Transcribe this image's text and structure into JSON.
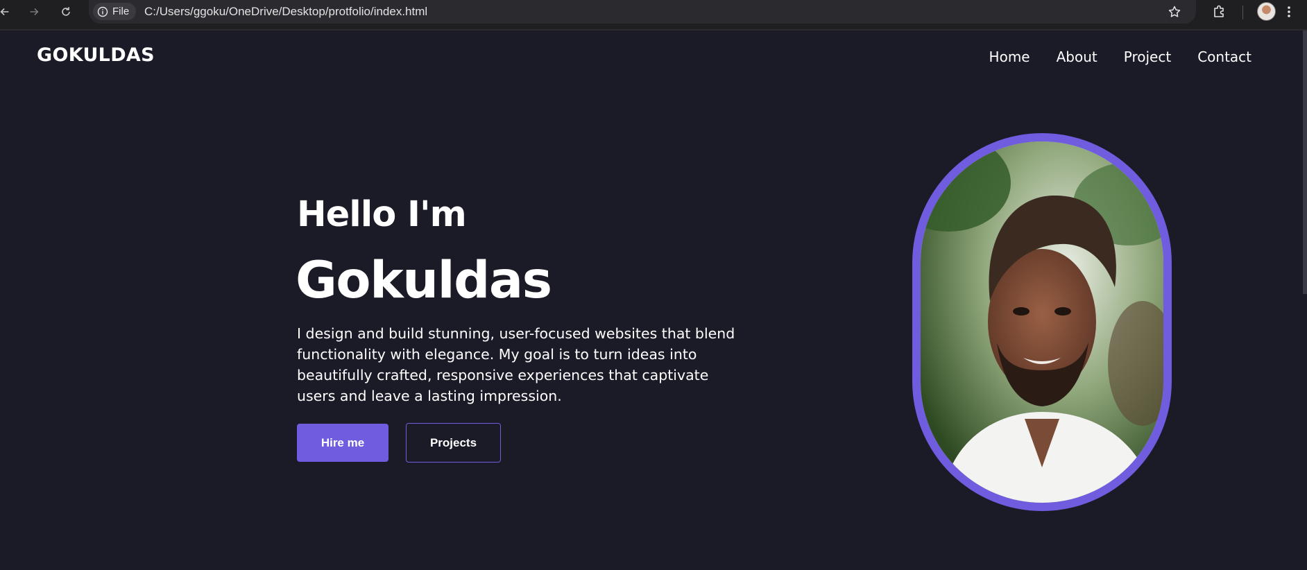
{
  "browser": {
    "site_chip_label": "File",
    "url": "C:/Users/ggoku/OneDrive/Desktop/protfolio/index.html"
  },
  "site": {
    "logo": "GOKULDAS",
    "nav": [
      "Home",
      "About",
      "Project",
      "Contact"
    ]
  },
  "hero": {
    "greeting": "Hello I'm",
    "name": "Gokuldas",
    "description": "I design and build stunning, user-focused websites that blend functionality with elegance. My goal is to turn ideas into beautifully crafted, responsive experiences that captivate users and leave a lasting impression.",
    "primary_button": "Hire me",
    "secondary_button": "Projects"
  },
  "colors": {
    "background": "#1b1a27",
    "accent": "#6f5cde",
    "text": "#ffffff"
  },
  "icons": [
    "back-arrow-icon",
    "forward-arrow-icon",
    "reload-icon",
    "info-icon",
    "star-icon",
    "extensions-icon",
    "profile-avatar",
    "kebab-menu-icon"
  ]
}
